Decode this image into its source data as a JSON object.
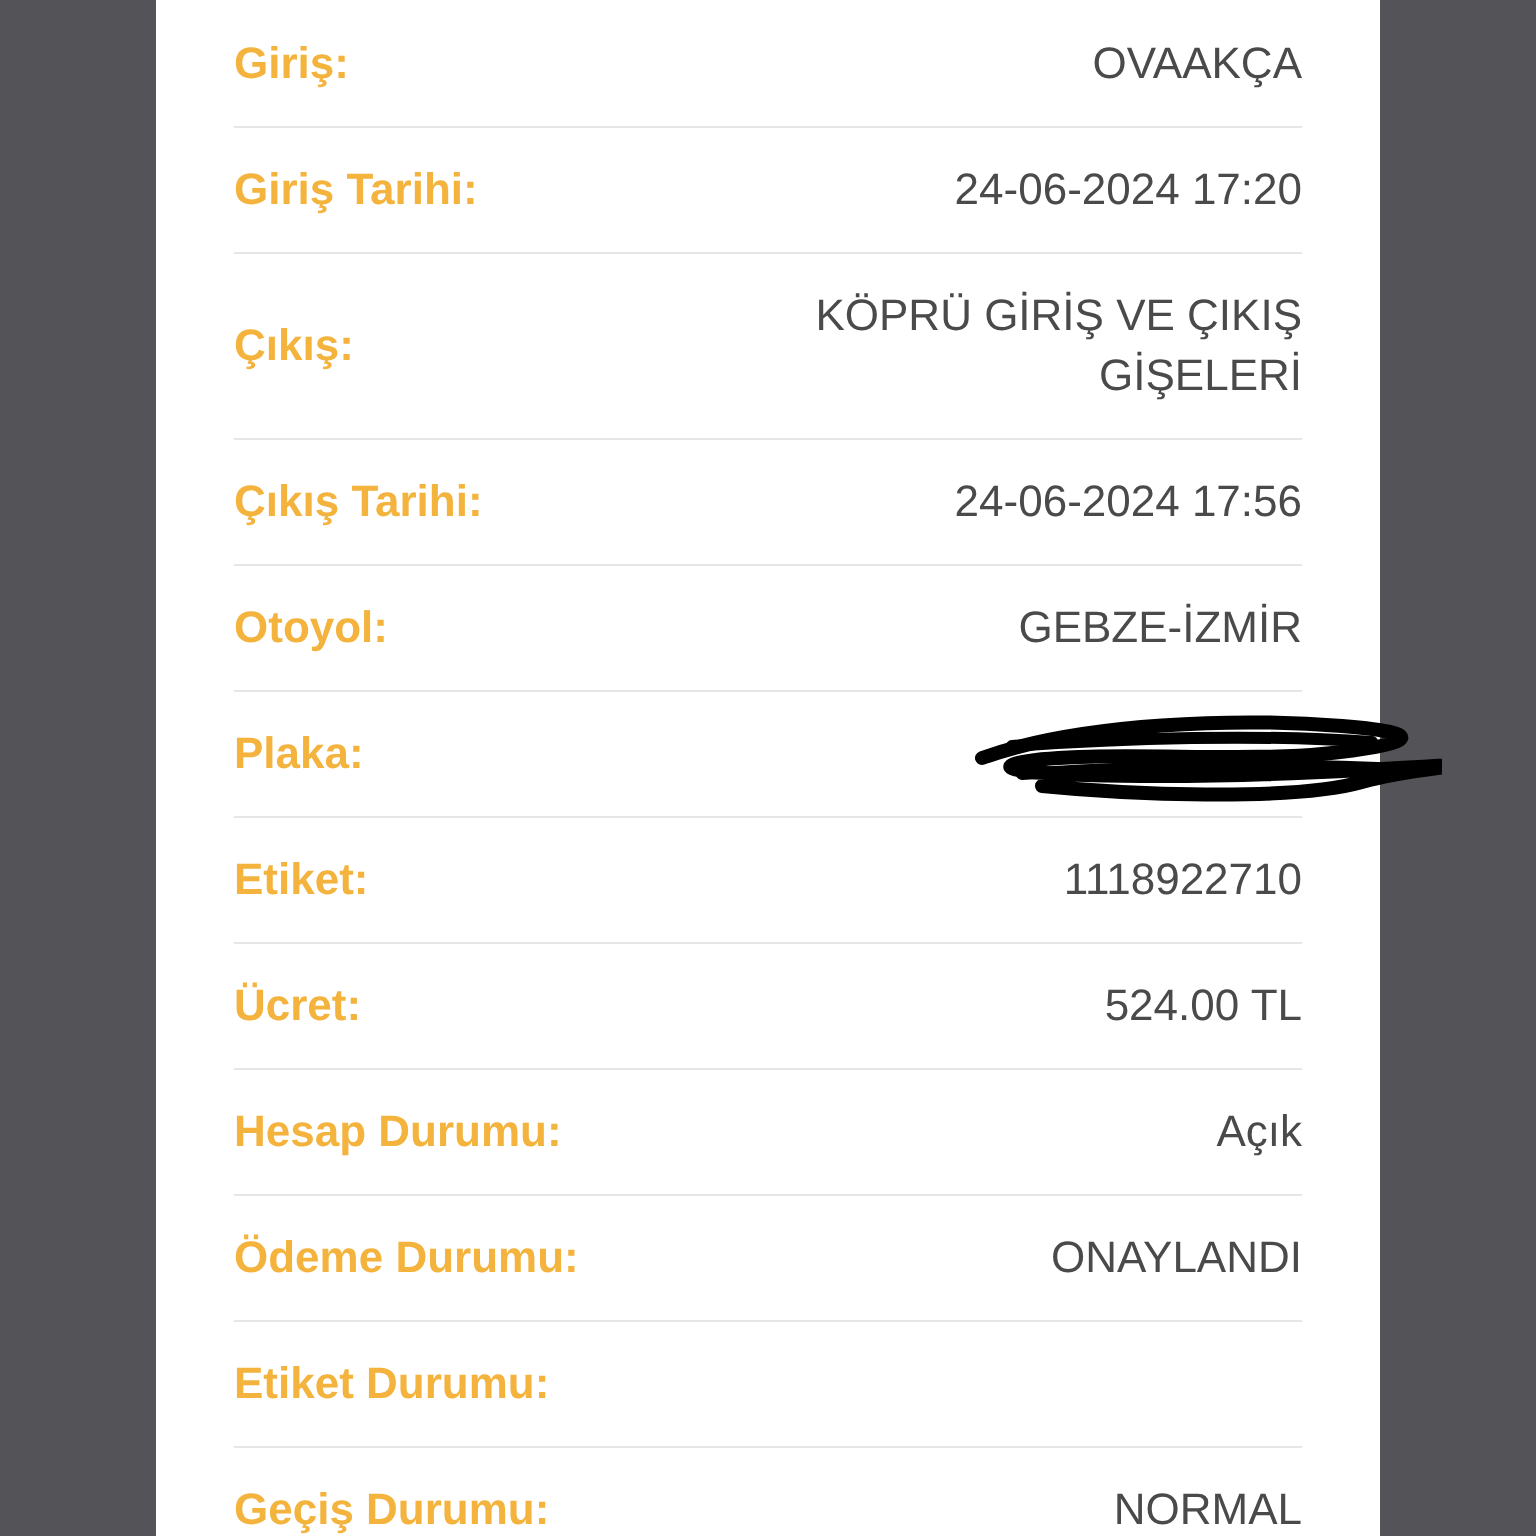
{
  "rows": [
    {
      "kind": "text",
      "label": "Giriş:",
      "value": "OVAAKÇA"
    },
    {
      "kind": "text",
      "label": "Giriş Tarihi:",
      "value": "24-06-2024 17:20"
    },
    {
      "kind": "text",
      "label": "Çıkış:",
      "value": "KÖPRÜ GİRİŞ VE ÇIKIŞ GİŞELERİ"
    },
    {
      "kind": "text",
      "label": "Çıkış Tarihi:",
      "value": "24-06-2024 17:56"
    },
    {
      "kind": "text",
      "label": "Otoyol:",
      "value": "GEBZE-İZMİR"
    },
    {
      "kind": "redacted",
      "label": "Plaka:"
    },
    {
      "kind": "text",
      "label": "Etiket:",
      "value": "1118922710"
    },
    {
      "kind": "text",
      "label": "Ücret:",
      "value": "524.00 TL"
    },
    {
      "kind": "text",
      "label": "Hesap Durumu:",
      "value": "Açık"
    },
    {
      "kind": "text",
      "label": "Ödeme Durumu:",
      "value": "ONAYLANDI"
    },
    {
      "kind": "text",
      "label": "Etiket Durumu:"
    },
    {
      "kind": "text",
      "label": "Geçiş Durumu:",
      "value": "NORMAL"
    }
  ]
}
